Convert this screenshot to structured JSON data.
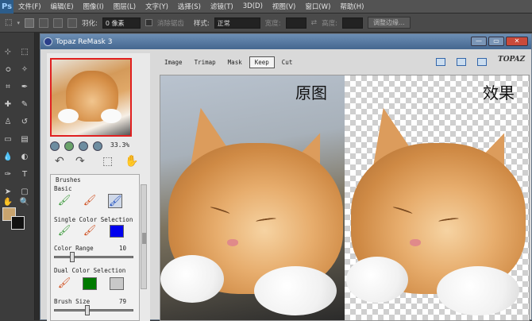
{
  "menubar": {
    "logo": "Ps",
    "items": [
      "文件(F)",
      "编辑(E)",
      "图像(I)",
      "图层(L)",
      "文字(Y)",
      "选择(S)",
      "滤镜(T)",
      "3D(D)",
      "视图(V)",
      "窗口(W)",
      "帮助(H)"
    ]
  },
  "options": {
    "feather_label": "羽化:",
    "feather_value": "0 像素",
    "antialias_label": "消除锯齿",
    "style_label": "样式:",
    "style_value": "正常",
    "width_label": "宽度:",
    "height_label": "高度:",
    "refine_button": "调整边缘..."
  },
  "window": {
    "title": "Topaz ReMask 3",
    "tabs": [
      "Image",
      "Trimap",
      "Mask",
      "Keep",
      "Cut"
    ],
    "active_tab": "Keep",
    "logo": "TOPAZ",
    "zoom": "33.3%"
  },
  "brushes": {
    "title": "Brushes",
    "basic": "Basic",
    "single": "Single Color Selection",
    "color_range_label": "Color Range",
    "color_range_value": "10",
    "color_range_fraction": 0.1,
    "dual": "Dual Color Selection",
    "brush_size_label": "Brush Size",
    "brush_size_value": "79",
    "brush_size_fraction": 0.4,
    "single_color": "#0000ee",
    "dual_color_1": "#007a00",
    "dual_color_2": "#c8c8c8"
  },
  "image": {
    "left_label": "原图",
    "right_label": "效果"
  },
  "colors": {
    "foreground": "#c9a46e",
    "background": "#111111"
  }
}
